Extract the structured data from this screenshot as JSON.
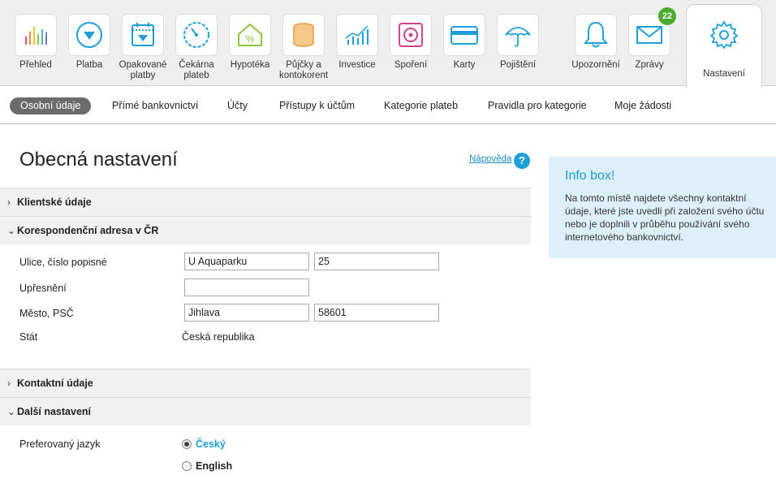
{
  "nav": {
    "items": [
      {
        "label": "Přehled",
        "icon": "chart-bars-icon"
      },
      {
        "label": "Platba",
        "icon": "payment-arrow-icon"
      },
      {
        "label": "Opakované platby",
        "icon": "calendar-arrow-icon"
      },
      {
        "label": "Čekárna plateb",
        "icon": "gauge-icon"
      },
      {
        "label": "Hypotéka",
        "icon": "house-percent-icon"
      },
      {
        "label": "Půjčky a kontokorent",
        "icon": "coin-stack-icon"
      },
      {
        "label": "Investice",
        "icon": "line-chart-icon"
      },
      {
        "label": "Spoření",
        "icon": "safe-icon"
      },
      {
        "label": "Karty",
        "icon": "card-icon"
      },
      {
        "label": "Pojištění",
        "icon": "umbrella-icon"
      },
      {
        "label": "Upozornění",
        "icon": "bell-icon"
      },
      {
        "label": "Zprávy",
        "icon": "envelope-icon",
        "badge": "22"
      }
    ],
    "active": {
      "label": "Nastavení",
      "icon": "gear-icon"
    }
  },
  "subnav": {
    "items": [
      "Osobní údaje",
      "Přímé bankovnictví",
      "Účty",
      "Přístupy k účtům",
      "Kategorie plateb",
      "Pravidla pro kategorie",
      "Moje žádosti"
    ]
  },
  "page": {
    "title": "Obecná nastavení",
    "help": "Nápověda",
    "help_icon": "?"
  },
  "sections": {
    "client": "Klientské údaje",
    "address": "Korespondenční adresa v ČR",
    "contact": "Kontaktní údaje",
    "other": "Další nastavení"
  },
  "address_form": {
    "street_label": "Ulice, číslo popisné",
    "street": "U Aquaparku",
    "number": "25",
    "note_label": "Upřesnění",
    "note": "",
    "city_label": "Město, PSČ",
    "city": "Jihlava",
    "zip": "58601",
    "state_label": "Stát",
    "state": "Česká republika"
  },
  "language": {
    "label": "Preferovaný jazyk",
    "options": [
      "Český",
      "English"
    ],
    "selected": "Český"
  },
  "infobox": {
    "title": "Info box!",
    "text": "Na tomto místě najdete všechny kontaktní údaje, které jste uvedli při založení svého účtu nebo je doplnili v průběhu používání svého internetového bankovnictví."
  },
  "colors": {
    "accent": "#1e9fd8",
    "badge": "#4aab2e",
    "infobox_bg": "#ddf0f9"
  }
}
